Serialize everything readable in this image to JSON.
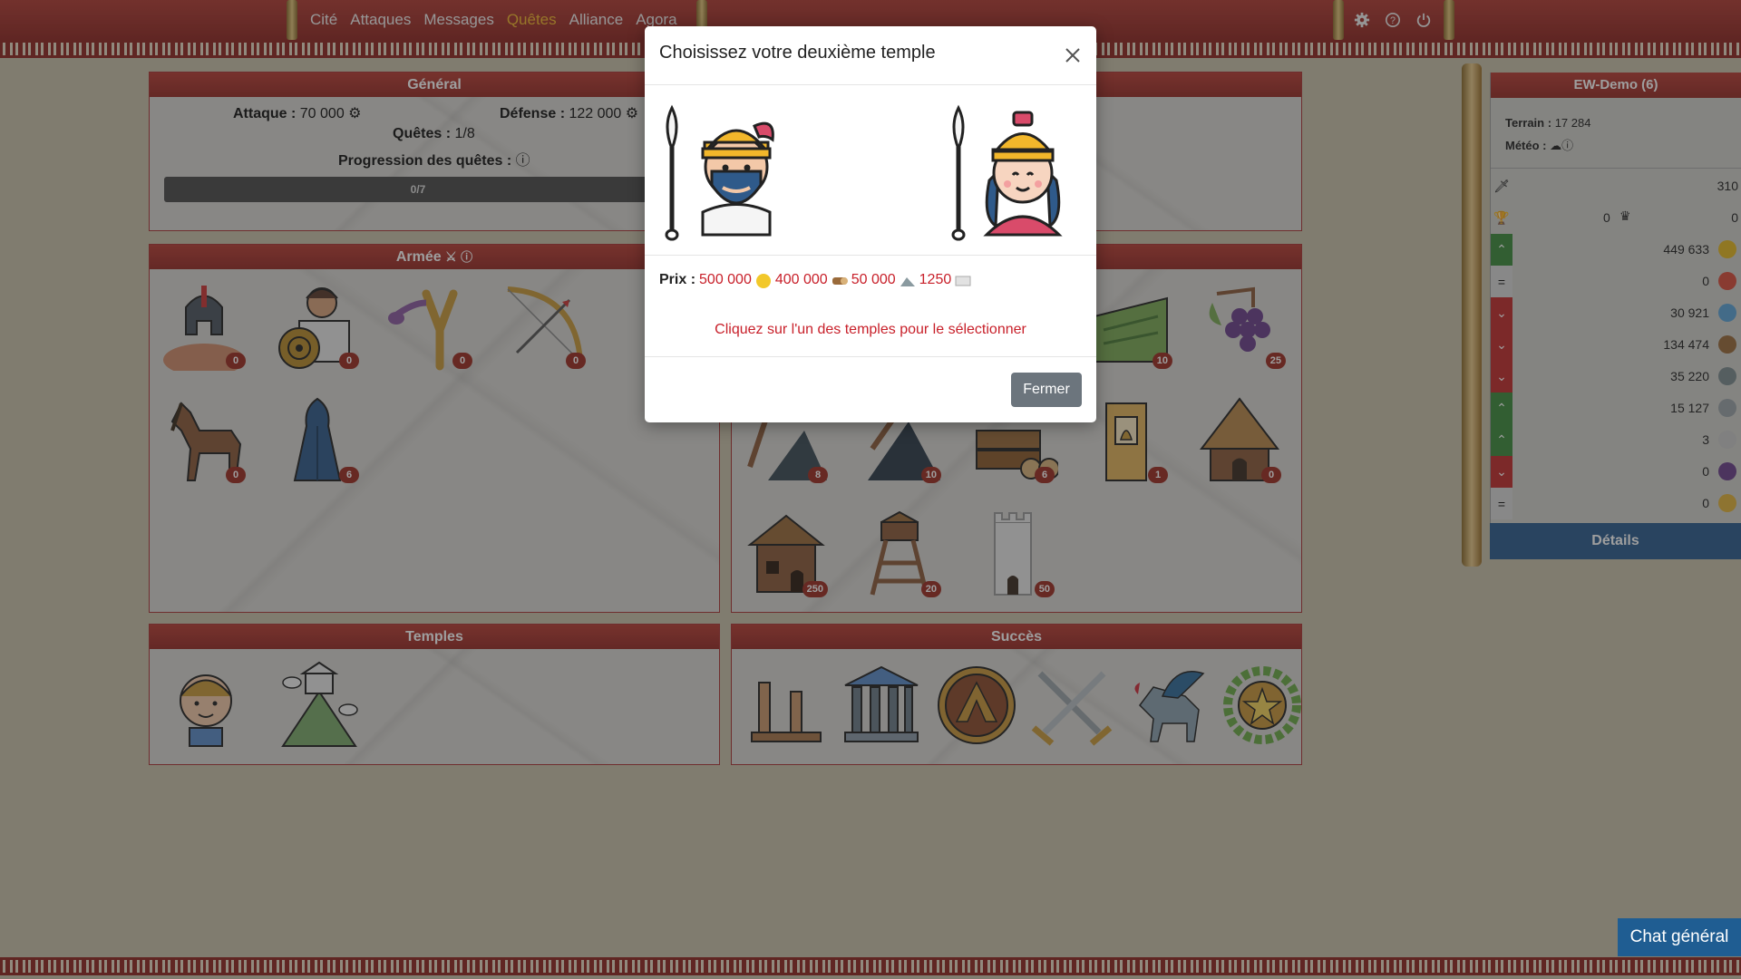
{
  "nav": {
    "items": [
      {
        "label": "Cité",
        "active": false
      },
      {
        "label": "Attaques",
        "active": false
      },
      {
        "label": "Messages",
        "active": false
      },
      {
        "label": "Quêtes",
        "active": true
      },
      {
        "label": "Alliance",
        "active": false
      },
      {
        "label": "Agora",
        "active": false
      }
    ],
    "icons": [
      "gear-icon",
      "help-icon",
      "power-icon"
    ]
  },
  "general": {
    "title": "Général",
    "attack_label": "Attaque :",
    "attack_value": "70 000",
    "defense_label": "Défense :",
    "defense_value": "122 000",
    "quests_label": "Quêtes :",
    "quests_value": "1/8",
    "progress_label": "Progression des quêtes :",
    "progress_text": "0/7"
  },
  "army": {
    "title": "Armée",
    "units": [
      {
        "icon": "spartan-warrior-icon",
        "count": "0"
      },
      {
        "icon": "hoplite-shield-icon",
        "count": "0"
      },
      {
        "icon": "slingshot-icon",
        "count": "0"
      },
      {
        "icon": "bow-icon",
        "count": "0"
      },
      {
        "icon": "horse-icon",
        "count": "0"
      },
      {
        "icon": "cloak-icon",
        "count": "6"
      }
    ]
  },
  "buildings": {
    "counts_row1": [
      "10",
      "25"
    ],
    "counts_row2": [
      "8",
      "10",
      "6",
      "1",
      "0"
    ],
    "counts_row3": [
      "250",
      "20",
      "50"
    ]
  },
  "temples": {
    "title": "Temples"
  },
  "success": {
    "title": "Succès"
  },
  "city": {
    "name": "EW-Demo (6)",
    "terrain_label": "Terrain :",
    "terrain_value": "17 284",
    "weather_label": "Météo :",
    "sword_value": "310",
    "trophy_value": "0",
    "crown_value": "0",
    "resources": [
      {
        "trend": "up",
        "value": "449 633",
        "icon": "gold-icon",
        "color": "#e6b820"
      },
      {
        "trend": "equal",
        "value": "0",
        "icon": "food-icon",
        "color": "#d94b3a"
      },
      {
        "trend": "down",
        "value": "30 921",
        "icon": "water-icon",
        "color": "#5aa3d8"
      },
      {
        "trend": "down",
        "value": "134 474",
        "icon": "wood-icon",
        "color": "#9a6a3a"
      },
      {
        "trend": "down",
        "value": "35 220",
        "icon": "stone-icon",
        "color": "#7b8a8f"
      },
      {
        "trend": "up",
        "value": "15 127",
        "icon": "iron-icon",
        "color": "#9aa3a8"
      },
      {
        "trend": "up",
        "value": "3",
        "icon": "marble-icon",
        "color": "#c8c8c8"
      },
      {
        "trend": "down",
        "value": "0",
        "icon": "grape-icon",
        "color": "#6a3f8a"
      },
      {
        "trend": "equal",
        "value": "0",
        "icon": "statue-icon",
        "color": "#e2b23a"
      }
    ],
    "details_label": "Détails"
  },
  "modal": {
    "title": "Choisissez votre deuxième temple",
    "price_label": "Prix :",
    "prices": [
      "500 000",
      "400 000",
      "50 000",
      "1250"
    ],
    "hint": "Cliquez sur l'un des temples pour le sélectionner",
    "close_label": "Fermer"
  },
  "chat": {
    "label": "Chat général"
  },
  "colors": {
    "accent": "#9b2b20",
    "active_nav": "#f2b72b",
    "details": "#2a5b8f"
  }
}
